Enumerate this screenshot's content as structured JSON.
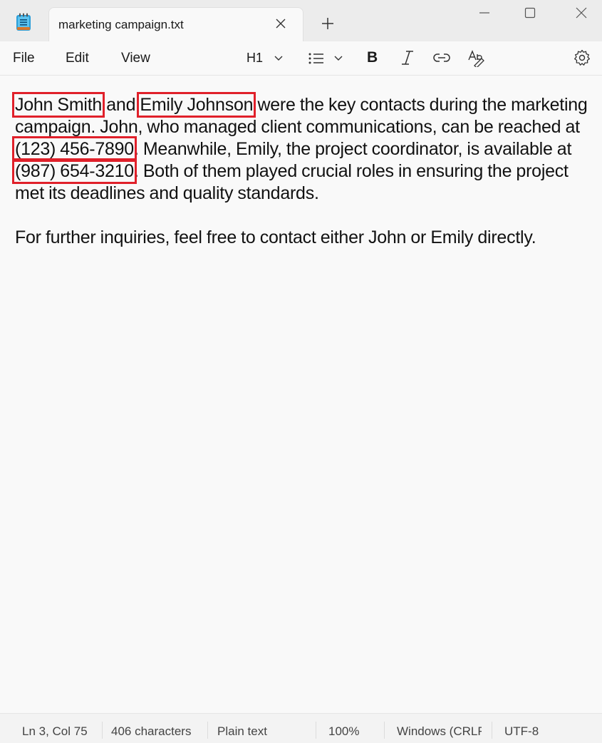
{
  "window": {
    "tab_title": "marketing campaign.txt"
  },
  "menu": {
    "file": "File",
    "edit": "Edit",
    "view": "View"
  },
  "toolbar": {
    "heading": "H1",
    "bold": "B"
  },
  "document": {
    "paragraph1": [
      {
        "text": "John Smith",
        "highlight": true
      },
      {
        "text": " and ",
        "highlight": false
      },
      {
        "text": "Emily Johnson",
        "highlight": true
      },
      {
        "text": " were the key contacts during the marketing campaign. John, who managed client communications, can be reached at ",
        "highlight": false
      },
      {
        "text": "(123) 456-7890",
        "highlight": true
      },
      {
        "text": ". Meanwhile, Emily, the project coordinator, is available at ",
        "highlight": false
      },
      {
        "text": "(987) 654-3210",
        "highlight": true
      },
      {
        "text": ". Both of them played crucial roles in ensuring the project met its deadlines and quality standards.",
        "highlight": false
      }
    ],
    "paragraph2": "For further inquiries, feel free to contact either John or Emily directly."
  },
  "statusbar": {
    "position": "Ln 3, Col 75",
    "characters": "406 characters",
    "format": "Plain text",
    "zoom": "100%",
    "line_ending": "Windows (CRLF)",
    "encoding": "UTF-8"
  },
  "colors": {
    "highlight_box": "#e0202a",
    "titlebar_bg": "#ececec",
    "editor_bg": "#f9f9f9"
  },
  "icons": [
    "notepad-app-icon",
    "close-icon",
    "plus-icon",
    "minimize-icon",
    "maximize-icon",
    "close-window-icon",
    "chevron-down-icon",
    "list-icon",
    "bold-icon",
    "italic-icon",
    "link-icon",
    "spellcheck-icon",
    "gear-icon"
  ]
}
